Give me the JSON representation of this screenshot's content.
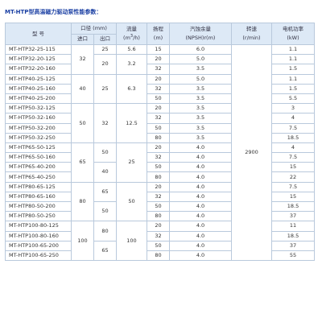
{
  "title": "MT-HTP型高温磁力驱动泵性能参数：",
  "headers": {
    "model": "型 号",
    "diameter": "口径 (mm)",
    "inlet": "进口",
    "outlet": "出口",
    "flow": "流量",
    "flow_unit_pre": "(m",
    "flow_unit_sup": "3",
    "flow_unit_post": "/h)",
    "head": "扬程",
    "head_unit": "(m)",
    "npsh": "汽蚀余量",
    "npsh_unit": "(NPSH)r(m)",
    "speed": "转速",
    "speed_unit": "(r/min)",
    "power": "电机功率",
    "power_unit": "(kW)"
  },
  "models": [
    "MT-HTP32-25-115",
    "MT-HTP32-20-125",
    "MT-HTP32-20-160",
    "MT-HTP40-25-125",
    "MT-HTP40-25-160",
    "MT-HTP40-25-200",
    "MT-HTP50-32-125",
    "MT-HTP50-32-160",
    "MT-HTP50-32-200",
    "MT-HTP50-32-250",
    "MT-HTP65-50-125",
    "MT-HTP65-50-160",
    "MT-HTP65-40-200",
    "MT-HTP65-40-250",
    "MT-HTP80-65-125",
    "MT-HTP80-65-160",
    "MT-HTP80-50-200",
    "MT-HTP80-50-250",
    "MT-HTP100-80-125",
    "MT-HTP100-80-160",
    "MT-HTP100-65-200",
    "MT-HTP100-65-250"
  ],
  "inlet": [
    "32",
    "40",
    "50",
    "65",
    "80",
    "100"
  ],
  "outlet": [
    "25",
    "20",
    "25",
    "32",
    "50",
    "40",
    "65",
    "50",
    "80",
    "65"
  ],
  "flow": [
    "5.6",
    "3.2",
    "6.3",
    "12.5",
    "25",
    "50",
    "100"
  ],
  "head": [
    "15",
    "20",
    "32",
    "20",
    "32",
    "50",
    "20",
    "32",
    "50",
    "80",
    "20",
    "32",
    "50",
    "80",
    "20",
    "32",
    "50",
    "80",
    "20",
    "32",
    "50",
    "80"
  ],
  "npsh": [
    "6.0",
    "5.0",
    "3.5",
    "5.0",
    "3.5",
    "3.5",
    "3.5",
    "3.5",
    "3.5",
    "3.5",
    "4.0",
    "4.0",
    "4.0",
    "4.0",
    "4.0",
    "4.0",
    "4.0",
    "4.0",
    "4.0",
    "4.0",
    "4.0",
    "4.0"
  ],
  "speed": "2900",
  "power": [
    "1.1",
    "1.1",
    "1.5",
    "1.1",
    "1.5",
    "5.5",
    "3",
    "4",
    "7.5",
    "18.5",
    "4",
    "7.5",
    "15",
    "22",
    "7.5",
    "15",
    "18.5",
    "37",
    "11",
    "18.5",
    "37",
    "55"
  ]
}
